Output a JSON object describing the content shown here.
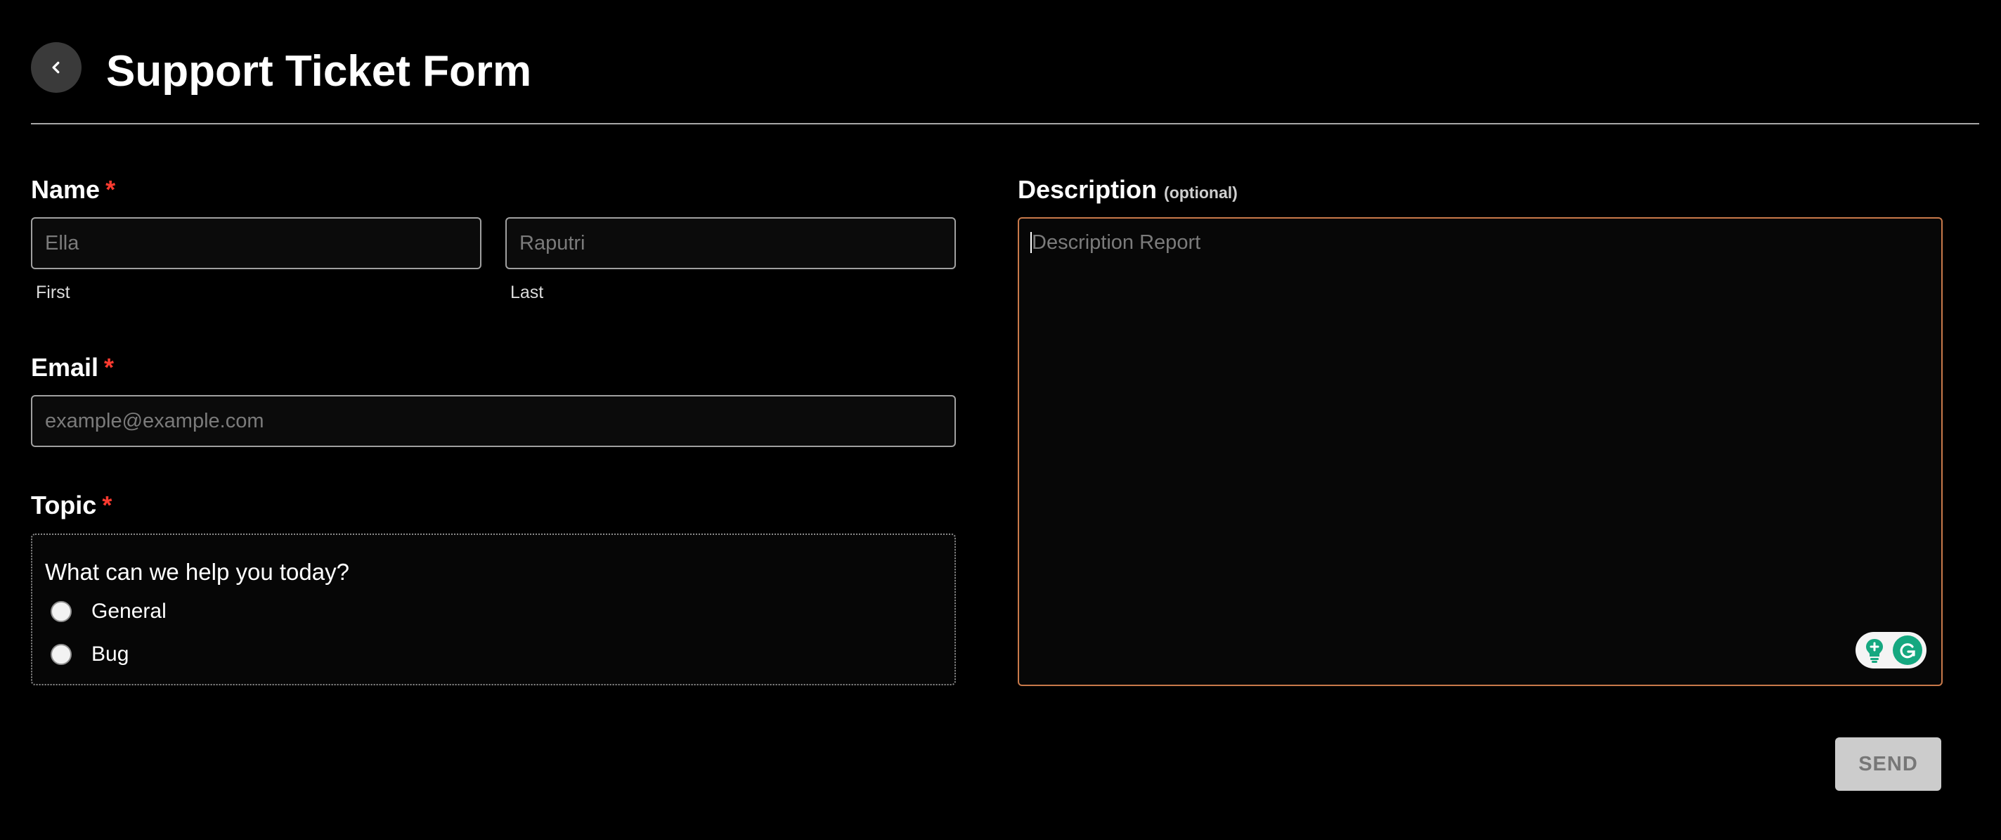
{
  "header": {
    "title": "Support Ticket Form",
    "back_icon": "chevron-left-icon"
  },
  "name": {
    "label": "Name",
    "required_mark": "*",
    "first": {
      "placeholder": "Ella",
      "sub_label": "First"
    },
    "last": {
      "placeholder": "Raputri",
      "sub_label": "Last"
    }
  },
  "email": {
    "label": "Email",
    "required_mark": "*",
    "placeholder": "example@example.com"
  },
  "topic": {
    "label": "Topic",
    "required_mark": "*",
    "question": "What can we help you today?",
    "options": [
      {
        "label": "General",
        "selected": false
      },
      {
        "label": "Bug",
        "selected": false
      }
    ]
  },
  "description": {
    "label": "Description",
    "note": "(optional)",
    "placeholder": "Description Report"
  },
  "assistant_widget": {
    "icons": [
      "lightbulb-icon",
      "grammarly-icon"
    ],
    "accent": "#15a880"
  },
  "actions": {
    "send_label": "SEND"
  },
  "colors": {
    "background": "#000000",
    "required": "#ff3b30",
    "focus_border": "#c8794a",
    "send_bg": "#cccccc"
  }
}
